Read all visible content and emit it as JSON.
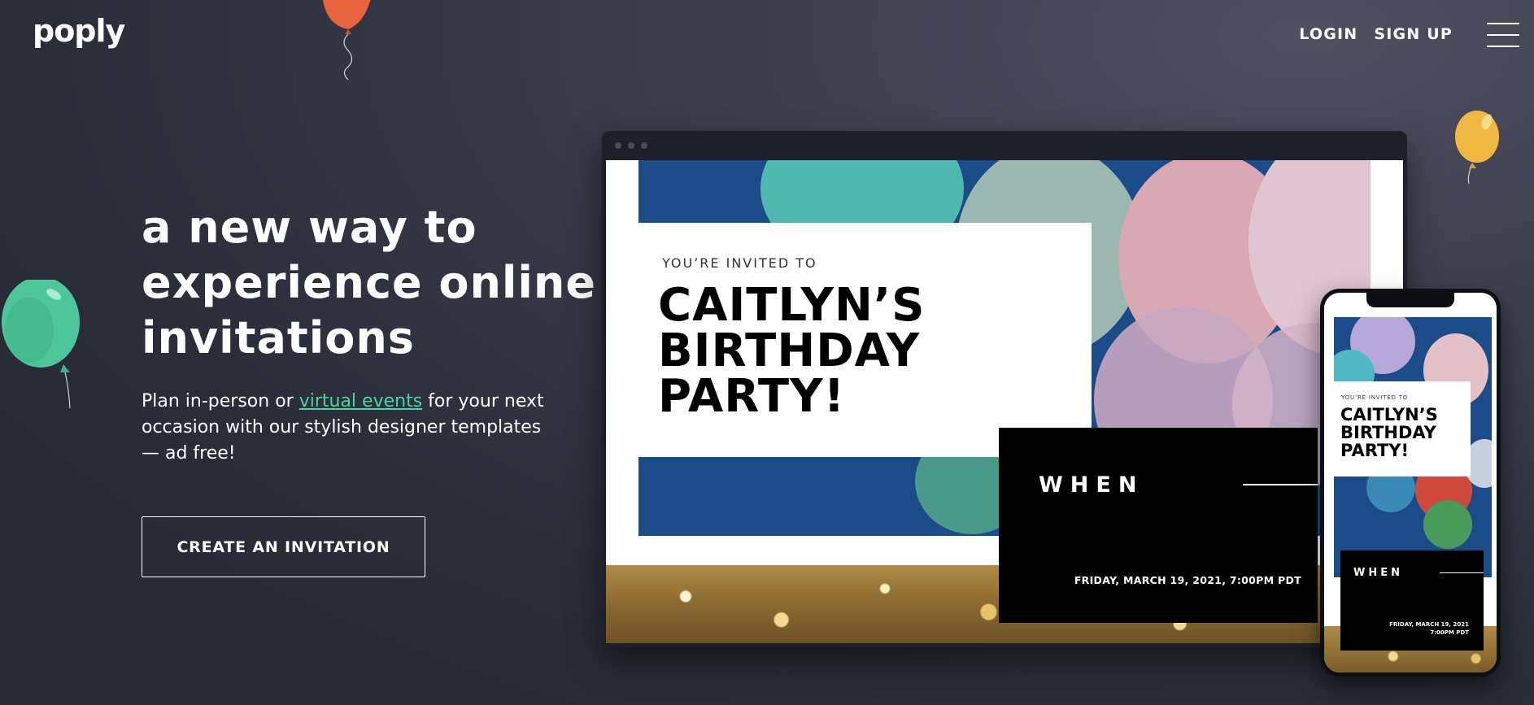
{
  "brand": {
    "logo_text": "poply"
  },
  "nav": {
    "login": "LOGIN",
    "signup": "SIGN UP"
  },
  "hero": {
    "title_line1": "a new way to",
    "title_line2": "experience online",
    "title_line3": "invitations",
    "text_before": "Plan in-person or ",
    "link": "virtual events",
    "text_after": " for your next occasion with our stylish designer templates — ad free!",
    "cta": "CREATE AN INVITATION"
  },
  "desktop_preview": {
    "kicker": "YOU’RE INVITED TO",
    "title_line1": "CAITLYN’S",
    "title_line2": "BIRTHDAY",
    "title_line3": "PARTY!",
    "when_label": "WHEN",
    "when_date": "FRIDAY, MARCH 19, 2021, 7:00PM PDT"
  },
  "mobile_preview": {
    "kicker": "YOU’RE INVITED TO",
    "title_line1": "CAITLYN’S",
    "title_line2": "BIRTHDAY",
    "title_line3": "PARTY!",
    "when_label": "WHEN",
    "when_date_line1": "FRIDAY, MARCH 19, 2021",
    "when_date_line2": "7:00PM PDT"
  },
  "colors": {
    "accent_link": "#45d6a4",
    "background_dark": "#2a2c38",
    "balloon_orange": "#e8633e",
    "balloon_green": "#4cc69a",
    "balloon_yellow": "#f0b841",
    "photo_blue": "#1c4b8a"
  },
  "icons": {
    "menu": "hamburger-menu-icon",
    "balloon_orange": "balloon-icon",
    "balloon_green": "balloon-icon",
    "balloon_yellow": "balloon-icon"
  }
}
